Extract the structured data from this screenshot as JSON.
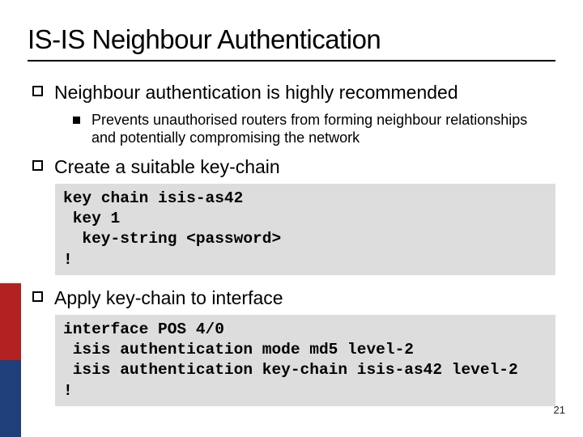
{
  "title": "IS-IS Neighbour Authentication",
  "bullets": [
    {
      "text": "Neighbour authentication is highly recommended",
      "sub": [
        {
          "text": "Prevents unauthorised routers from forming neighbour relationships and potentially compromising the network"
        }
      ]
    },
    {
      "text": "Create a suitable key-chain",
      "code": "key chain isis-as42\n key 1\n  key-string <password>\n!"
    },
    {
      "text": "Apply key-chain to interface",
      "code": "interface POS 4/0\n isis authentication mode md5 level-2\n isis authentication key-chain isis-as42 level-2\n!"
    }
  ],
  "page_number": "21"
}
